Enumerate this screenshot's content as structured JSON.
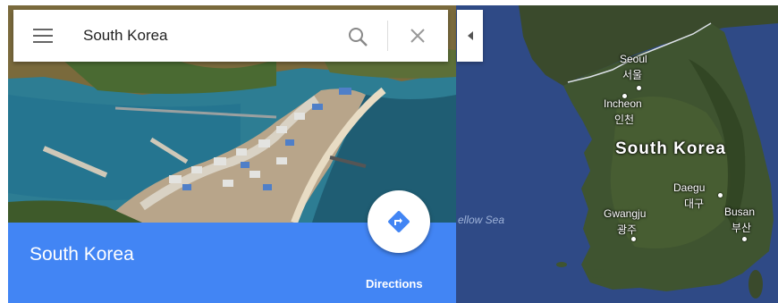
{
  "search": {
    "value": "South Korea"
  },
  "place": {
    "title": "South Korea",
    "directions_label": "Directions"
  },
  "map": {
    "country_label": "South Korea",
    "sea_label": "ellow Sea",
    "cities": [
      {
        "name": "Seoul",
        "korean": "서울"
      },
      {
        "name": "Incheon",
        "korean": "인천"
      },
      {
        "name": "Daegu",
        "korean": "대구"
      },
      {
        "name": "Gwangju",
        "korean": "광주"
      },
      {
        "name": "Busan",
        "korean": "부산"
      }
    ]
  },
  "colors": {
    "accent": "#4285f4",
    "map_water": "#2f4a86"
  }
}
